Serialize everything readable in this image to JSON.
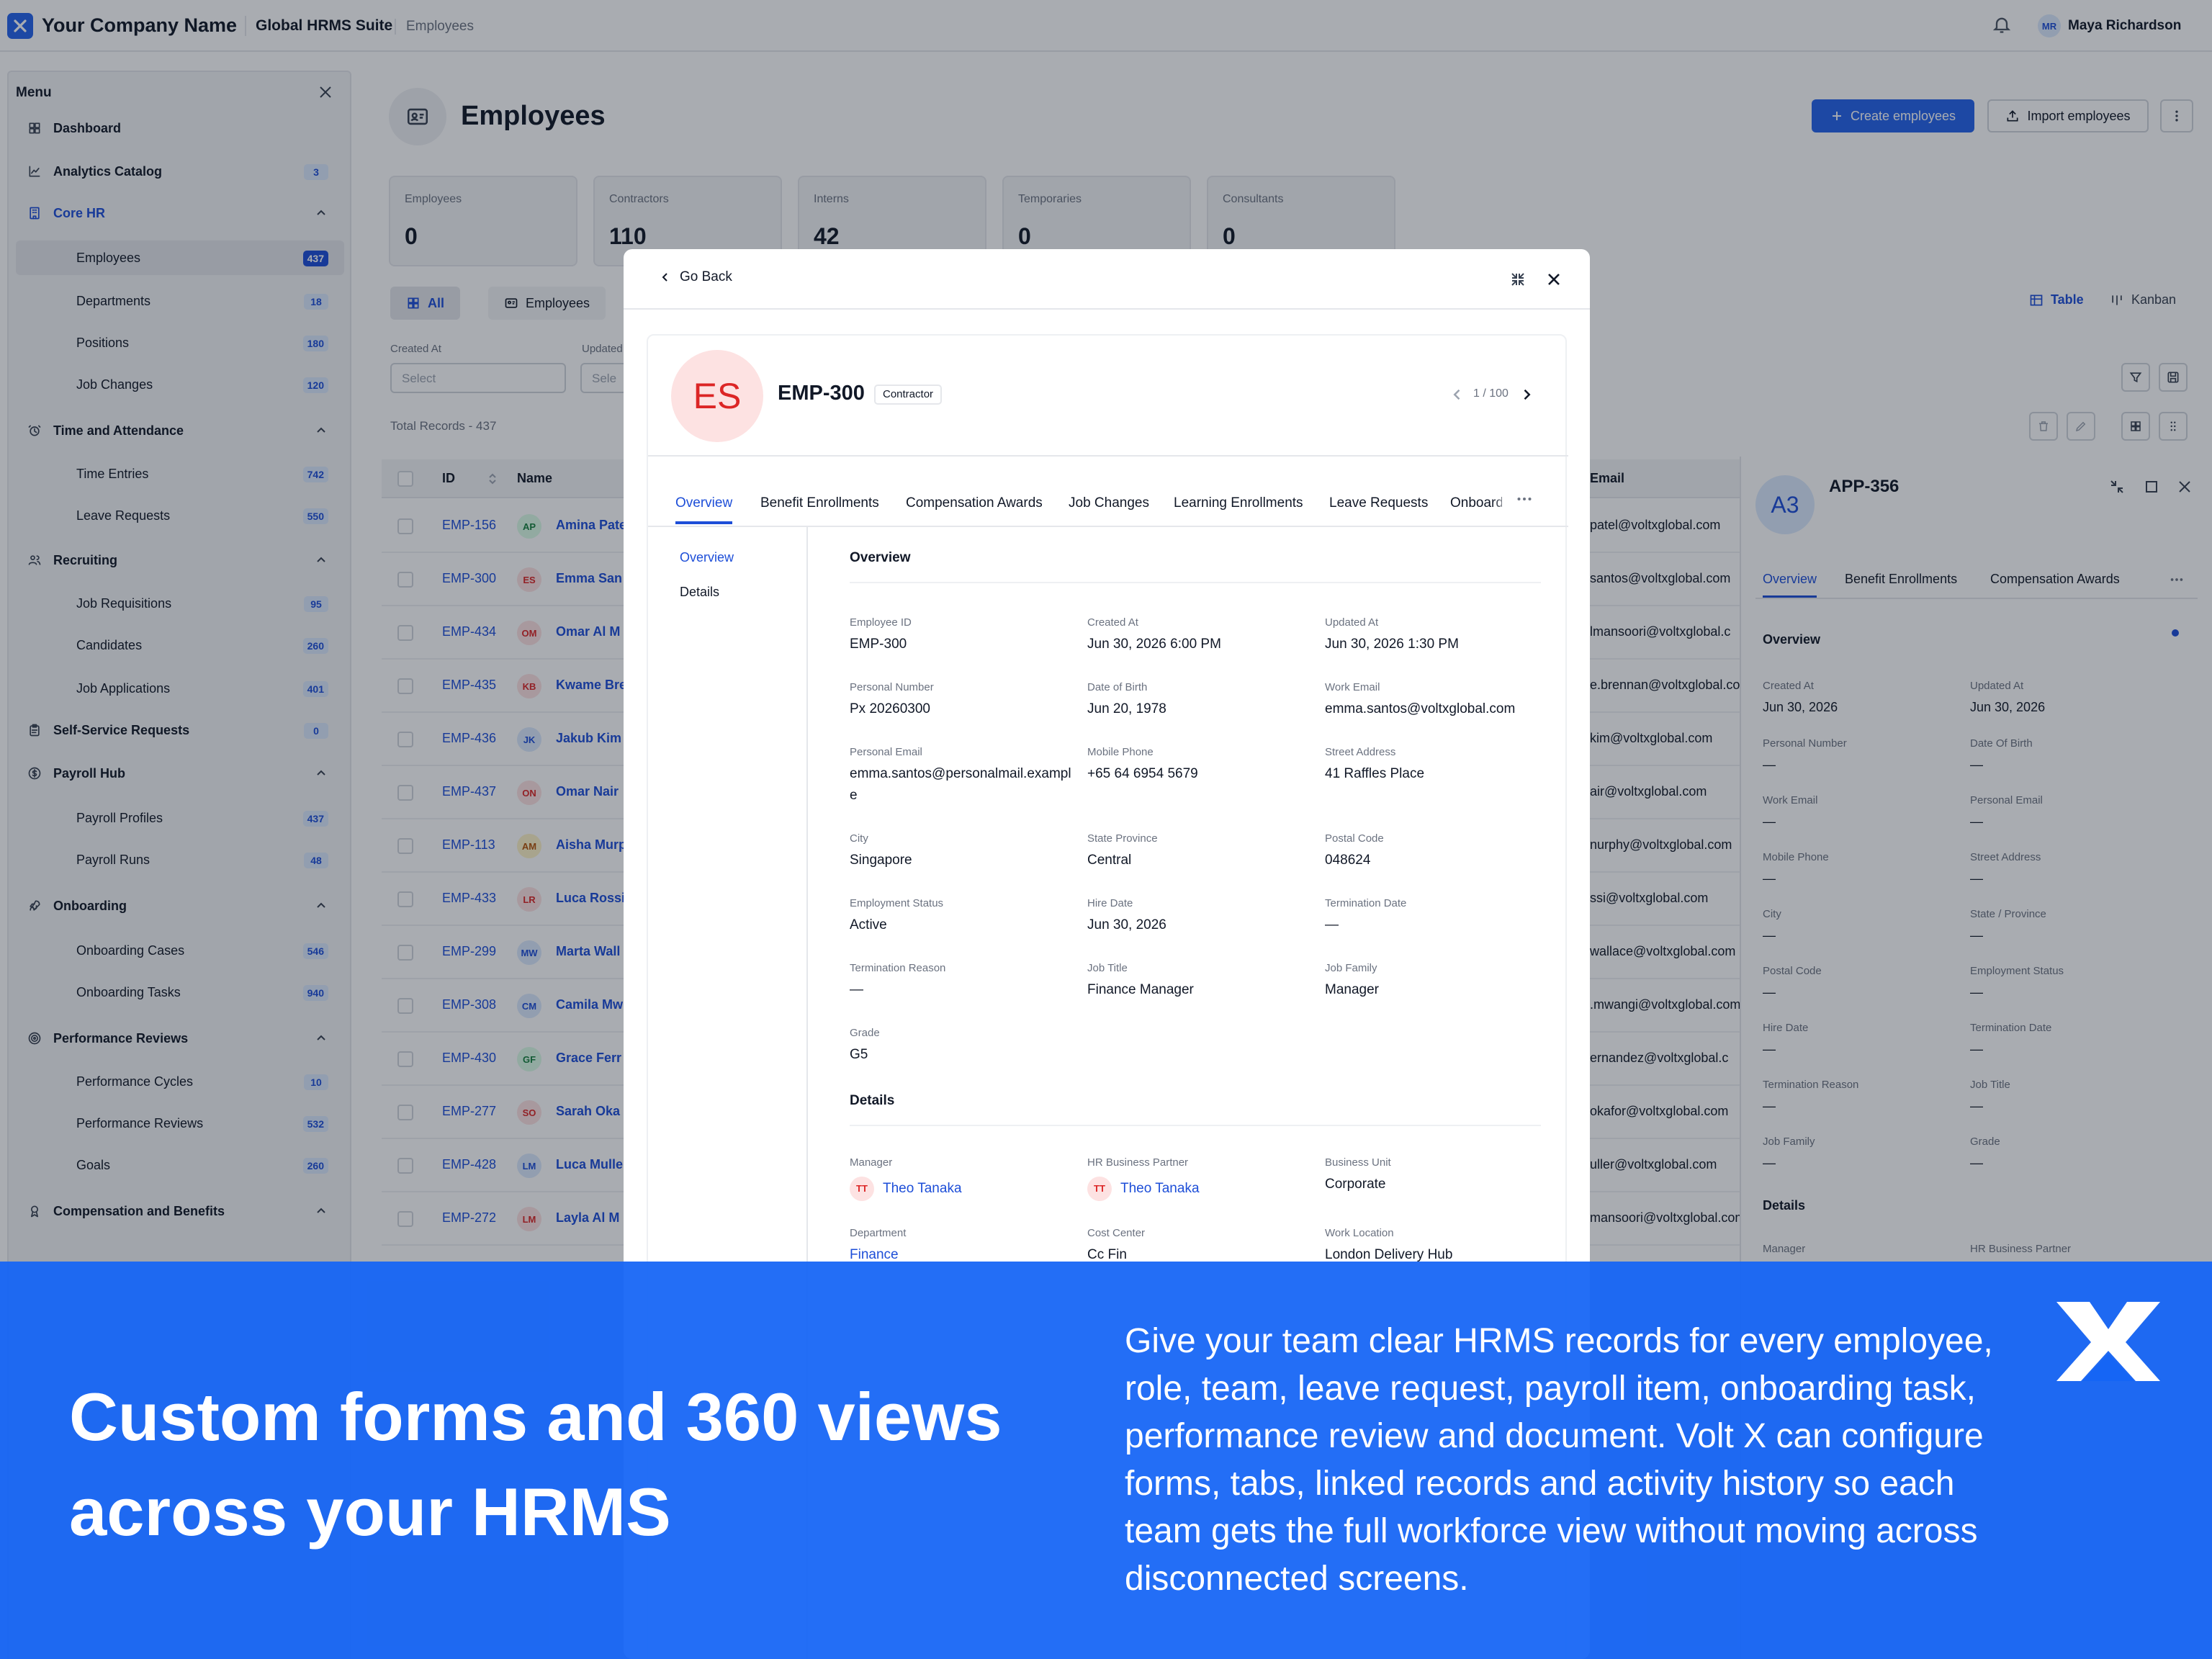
{
  "topbar": {
    "company": "Your Company Name",
    "suite": "Global HRMS Suite",
    "breadcrumb": "Employees",
    "user_initials": "MR",
    "user_name": "Maya Richardson"
  },
  "sidebar": {
    "title": "Menu",
    "items": [
      {
        "label": "Dashboard",
        "icon": "dashboard-icon"
      },
      {
        "label": "Analytics Catalog",
        "icon": "chart-line-icon",
        "badge": "3"
      },
      {
        "label": "Core HR",
        "icon": "building-icon",
        "expanded": true
      },
      {
        "label": "Employees",
        "badge": "437",
        "active": true
      },
      {
        "label": "Departments",
        "badge": "18"
      },
      {
        "label": "Positions",
        "badge": "180"
      },
      {
        "label": "Job Changes",
        "badge": "120"
      },
      {
        "label": "Time and Attendance",
        "icon": "clock-icon",
        "expanded": true
      },
      {
        "label": "Time Entries",
        "badge": "742"
      },
      {
        "label": "Leave Requests",
        "badge": "550"
      },
      {
        "label": "Recruiting",
        "icon": "users-icon",
        "expanded": true
      },
      {
        "label": "Job Requisitions",
        "badge": "95"
      },
      {
        "label": "Candidates",
        "badge": "260"
      },
      {
        "label": "Job Applications",
        "badge": "401"
      },
      {
        "label": "Self-Service Requests",
        "icon": "clipboard-icon",
        "badge": "0"
      },
      {
        "label": "Payroll Hub",
        "icon": "dollar-icon",
        "expanded": true
      },
      {
        "label": "Payroll Profiles",
        "badge": "437"
      },
      {
        "label": "Payroll Runs",
        "badge": "48"
      },
      {
        "label": "Onboarding",
        "icon": "rocket-icon",
        "expanded": true
      },
      {
        "label": "Onboarding Cases",
        "badge": "546"
      },
      {
        "label": "Onboarding Tasks",
        "badge": "940"
      },
      {
        "label": "Performance Reviews",
        "icon": "target-icon",
        "expanded": true
      },
      {
        "label": "Performance Cycles",
        "badge": "10"
      },
      {
        "label": "Performance Reviews",
        "badge": "532"
      },
      {
        "label": "Goals",
        "badge": "260"
      },
      {
        "label": "Compensation and Benefits",
        "icon": "award-icon",
        "expanded": true
      }
    ]
  },
  "page": {
    "title": "Employees",
    "create_label": "Create employees",
    "import_label": "Import employees",
    "stats": [
      {
        "label": "Employees",
        "value": "0"
      },
      {
        "label": "Contractors",
        "value": "110"
      },
      {
        "label": "Interns",
        "value": "42"
      },
      {
        "label": "Temporaries",
        "value": "0"
      },
      {
        "label": "Consultants",
        "value": "0"
      }
    ],
    "filter_tabs": [
      "All",
      "Employees"
    ],
    "view_table": "Table",
    "view_kanban": "Kanban",
    "filter_created_label": "Created At",
    "filter_updated_label": "Updated",
    "select_placeholder": "Select",
    "select_placeholder_short": "Sele",
    "total_records": "Total Records - 437",
    "columns": {
      "id": "ID",
      "name": "Name",
      "email": "Email"
    },
    "rows": [
      {
        "id": "EMP-156",
        "initials": "AP",
        "name": "Amina Pate",
        "email": "patel@voltxglobal.com",
        "bg": "#dcfce7",
        "fg": "#15803d"
      },
      {
        "id": "EMP-300",
        "initials": "ES",
        "name": "Emma San",
        "email": "santos@voltxglobal.com",
        "bg": "#fde2e2",
        "fg": "#dc2626"
      },
      {
        "id": "EMP-434",
        "initials": "OM",
        "name": "Omar Al M",
        "email": "lmansoori@voltxglobal.c",
        "bg": "#fde2e2",
        "fg": "#dc2626"
      },
      {
        "id": "EMP-435",
        "initials": "KB",
        "name": "Kwame Bre",
        "email": "e.brennan@voltxglobal.com",
        "bg": "#fde2e2",
        "fg": "#dc2626"
      },
      {
        "id": "EMP-436",
        "initials": "JK",
        "name": "Jakub Kim",
        "email": "kim@voltxglobal.com",
        "bg": "#dbeafe",
        "fg": "#1d4ed8"
      },
      {
        "id": "EMP-437",
        "initials": "ON",
        "name": "Omar Nair",
        "email": "air@voltxglobal.com",
        "bg": "#fde2e2",
        "fg": "#dc2626"
      },
      {
        "id": "EMP-113",
        "initials": "AM",
        "name": "Aisha Murp",
        "email": "nurphy@voltxglobal.com",
        "bg": "#fef3c7",
        "fg": "#b45309"
      },
      {
        "id": "EMP-433",
        "initials": "LR",
        "name": "Luca Rossi",
        "email": "ssi@voltxglobal.com",
        "bg": "#fde2e2",
        "fg": "#dc2626"
      },
      {
        "id": "EMP-299",
        "initials": "MW",
        "name": "Marta Wall",
        "email": "wallace@voltxglobal.com",
        "bg": "#dbeafe",
        "fg": "#1d4ed8"
      },
      {
        "id": "EMP-308",
        "initials": "CM",
        "name": "Camila Mw",
        "email": ".mwangi@voltxglobal.com",
        "bg": "#dbeafe",
        "fg": "#1d4ed8"
      },
      {
        "id": "EMP-430",
        "initials": "GF",
        "name": "Grace Ferr",
        "email": "ernandez@voltxglobal.c",
        "bg": "#dcfce7",
        "fg": "#15803d"
      },
      {
        "id": "EMP-277",
        "initials": "SO",
        "name": "Sarah Oka",
        "email": "okafor@voltxglobal.com",
        "bg": "#fde2e2",
        "fg": "#dc2626"
      },
      {
        "id": "EMP-428",
        "initials": "LM",
        "name": "Luca Mulle",
        "email": "uller@voltxglobal.com",
        "bg": "#dbeafe",
        "fg": "#1d4ed8"
      },
      {
        "id": "EMP-272",
        "initials": "LM",
        "name": "Layla Al M",
        "email": "mansoori@voltxglobal.com",
        "bg": "#fde2e2",
        "fg": "#dc2626"
      }
    ]
  },
  "drawer": {
    "initials": "A3",
    "title": "APP-356",
    "tabs": [
      "Overview",
      "Benefit Enrollments",
      "Compensation Awards"
    ],
    "section_overview": "Overview",
    "section_details": "Details",
    "fields": [
      {
        "label": "Created At",
        "value": "Jun 30, 2026"
      },
      {
        "label": "Updated At",
        "value": "Jun 30, 2026"
      },
      {
        "label": "Personal Number",
        "value": "—"
      },
      {
        "label": "Date Of Birth",
        "value": "—"
      },
      {
        "label": "Work Email",
        "value": "—"
      },
      {
        "label": "Personal Email",
        "value": "—"
      },
      {
        "label": "Mobile Phone",
        "value": "—"
      },
      {
        "label": "Street Address",
        "value": "—"
      },
      {
        "label": "City",
        "value": "—"
      },
      {
        "label": "State / Province",
        "value": "—"
      },
      {
        "label": "Postal Code",
        "value": "—"
      },
      {
        "label": "Employment Status",
        "value": "—"
      },
      {
        "label": "Hire Date",
        "value": "—"
      },
      {
        "label": "Termination Date",
        "value": "—"
      },
      {
        "label": "Termination Reason",
        "value": "—"
      },
      {
        "label": "Job Title",
        "value": "—"
      },
      {
        "label": "Job Family",
        "value": "—"
      },
      {
        "label": "Grade",
        "value": "—"
      }
    ],
    "detail_labels": [
      "Manager",
      "HR Business Partner"
    ]
  },
  "modal": {
    "go_back": "Go Back",
    "initials": "ES",
    "title": "EMP-300",
    "badge": "Contractor",
    "pager": "1 / 100",
    "tabs": [
      "Overview",
      "Benefit Enrollments",
      "Compensation Awards",
      "Job Changes",
      "Learning Enrollments",
      "Leave Requests",
      "Onboard"
    ],
    "nav": [
      "Overview",
      "Details"
    ],
    "section_overview": "Overview",
    "section_details": "Details",
    "fields": [
      {
        "label": "Employee ID",
        "value": "EMP-300"
      },
      {
        "label": "Created At",
        "value": "Jun 30, 2026 6:00 PM"
      },
      {
        "label": "Updated At",
        "value": "Jun 30, 2026 1:30 PM"
      },
      {
        "label": "Personal Number",
        "value": "Px 20260300"
      },
      {
        "label": "Date of Birth",
        "value": "Jun 20, 1978"
      },
      {
        "label": "Work Email",
        "value": "emma.santos@voltxglobal.com"
      },
      {
        "label": "Personal Email",
        "value": "emma.santos@personalmail.example"
      },
      {
        "label": "Mobile Phone",
        "value": "+65 64 6954 5679"
      },
      {
        "label": "Street Address",
        "value": "41 Raffles Place"
      },
      {
        "label": "City",
        "value": "Singapore"
      },
      {
        "label": "State Province",
        "value": "Central"
      },
      {
        "label": "Postal Code",
        "value": "048624"
      },
      {
        "label": "Employment Status",
        "value": "Active"
      },
      {
        "label": "Hire Date",
        "value": "Jun 30, 2026"
      },
      {
        "label": "Termination Date",
        "value": "—"
      },
      {
        "label": "Termination Reason",
        "value": "—"
      },
      {
        "label": "Job Title",
        "value": "Finance Manager"
      },
      {
        "label": "Job Family",
        "value": "Manager"
      },
      {
        "label": "Grade",
        "value": "G5"
      }
    ],
    "details": [
      {
        "label": "Manager",
        "value": "Theo Tanaka",
        "initials": "TT",
        "link": true
      },
      {
        "label": "HR Business Partner",
        "value": "Theo Tanaka",
        "initials": "TT",
        "link": true
      },
      {
        "label": "Business Unit",
        "value": "Corporate"
      },
      {
        "label": "Department",
        "value": "Finance",
        "link": true
      },
      {
        "label": "Cost Center",
        "value": "Cc Fin"
      },
      {
        "label": "Work Location",
        "value": "London Delivery Hub"
      }
    ]
  },
  "promo": {
    "headline": "Custom forms and 360 views across your HRMS",
    "body": "Give your team clear HRMS records for every employee, role, team, leave request, payroll item, onboarding task, performance review and document. Volt X can configure forms, tabs, linked records and activity history so each team gets the full workforce view without moving across disconnected screens.",
    "brand_color": "#1565f5"
  }
}
